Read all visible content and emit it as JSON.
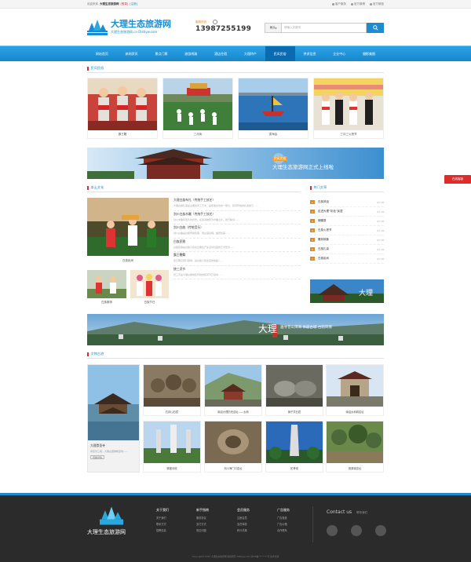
{
  "topbar": {
    "welcome": "欢迎来到",
    "site": "大理生态旅游网",
    "login": "[登录]",
    "register": "[注册]",
    "links": [
      "客户服务",
      "官方微博",
      "官方微信"
    ]
  },
  "header": {
    "logo_name": "大理生态旅游网",
    "logo_sub": "大理生态旅游网.cn  Dlstlyw.com",
    "hotline_label": "客服热线",
    "hotline": "13987255199",
    "search_select": "景点",
    "search_placeholder": "请输入关键词"
  },
  "nav": [
    "网站首页",
    "新闻资讯",
    "景点门票",
    "旅游线路",
    "酒店住宿",
    "大理特产",
    "民风民俗",
    "供求信息",
    "企业中心",
    "摄影美图"
  ],
  "sections": {
    "folk": "民风民俗",
    "culture": "本土文化",
    "hot": "热门文章",
    "relics": "文物古迹"
  },
  "folk_items": [
    {
      "caption": "霸王鞭"
    },
    {
      "caption": "三月街"
    },
    {
      "caption": "耍海会"
    },
    {
      "caption": "三月三火把节"
    }
  ],
  "banner1": {
    "tag": "民风民俗",
    "text": "大理生态旅游网正式上线啦"
  },
  "culture": {
    "main_caption": "白族民间",
    "small_captions": [
      "白族服饰",
      "白族节日"
    ],
    "articles": [
      {
        "title": "大理白族布扎（传统手工技艺）",
        "desc": "大理白族扎染是主要的手工艺术，是民族文化的一部分，民间传统的扎染技艺……"
      },
      {
        "title": "剑川白族木雕（传统手工技艺）",
        "desc": "剑川木雕有悠久的历史，在民间被称为木雕之乡，技艺精湛……"
      },
      {
        "title": "剑川白曲（传统音乐）",
        "desc": "剑川白曲是白族传统民歌，用白语演唱，曲调优美……"
      },
      {
        "title": "白族民歌",
        "desc": "白族民歌是白族人民在长期生产生活中创造的艺术形式……"
      },
      {
        "title": "霸王鞭舞",
        "desc": "霸王鞭又称打莲响，是白族人民喜爱的舞蹈……"
      },
      {
        "title": "绕三灵节",
        "desc": "绕三灵是大理白族地区传统的民间节日活动……"
      }
    ]
  },
  "hot": [
    {
      "n": "1",
      "title": "白族风俗",
      "date": "07-18"
    },
    {
      "n": "2",
      "title": "走进大理“彩色”民居",
      "date": "07-18"
    },
    {
      "n": "3",
      "title": "蝴蝶泉",
      "date": "07-18"
    },
    {
      "n": "4",
      "title": "白族火把节",
      "date": "07-18"
    },
    {
      "n": "5",
      "title": "雕刻映象",
      "date": "07-18"
    },
    {
      "n": "6",
      "title": "白族扎染",
      "date": "07-18"
    },
    {
      "n": "7",
      "title": "白族民间",
      "date": "07-18"
    }
  ],
  "banner2": {
    "title": "大理",
    "text": "遍寻苍山洱海 体验古城 古韵风情"
  },
  "relics_feature": {
    "title": "大理崇圣寺",
    "desc": "崇圣寺三塔，大理古国佛教圣地……",
    "more": "查看详情"
  },
  "relics": [
    "石钟山石窟",
    "南诏大理历史遗址——太和",
    "狮子关石窟",
    "南诏太和城遗址",
    "佛图寺塔",
    "剑川海门口遗址",
    "蛇骨塔",
    "德源城遗址"
  ],
  "sidetag": "在线客服",
  "footer": {
    "logo": "大理生态旅游网",
    "cols": [
      {
        "h": "关于我们",
        "l": [
          "关于我们",
          "联系方式",
          "招聘信息"
        ]
      },
      {
        "h": "新手指南",
        "l": [
          "服务协议",
          "支付方式",
          "常见问题"
        ]
      },
      {
        "h": "会员服务",
        "l": [
          "注册会员",
          "会员特权",
          "积分兑换"
        ]
      },
      {
        "h": "广告服务",
        "l": [
          "广告投放",
          "广告价格",
          "合作联系"
        ]
      }
    ],
    "contact": "Contact  us",
    "contact_sub": "联系我们",
    "copyright": "Copyright©2015 大理生态旅游网 版权所有  Dlstlyw.com  滇ICP备********号  技术支持"
  },
  "colors": {
    "brand": "#1b8cd1",
    "accent": "#e02b2b",
    "nav_active": "#0b6bb0"
  }
}
